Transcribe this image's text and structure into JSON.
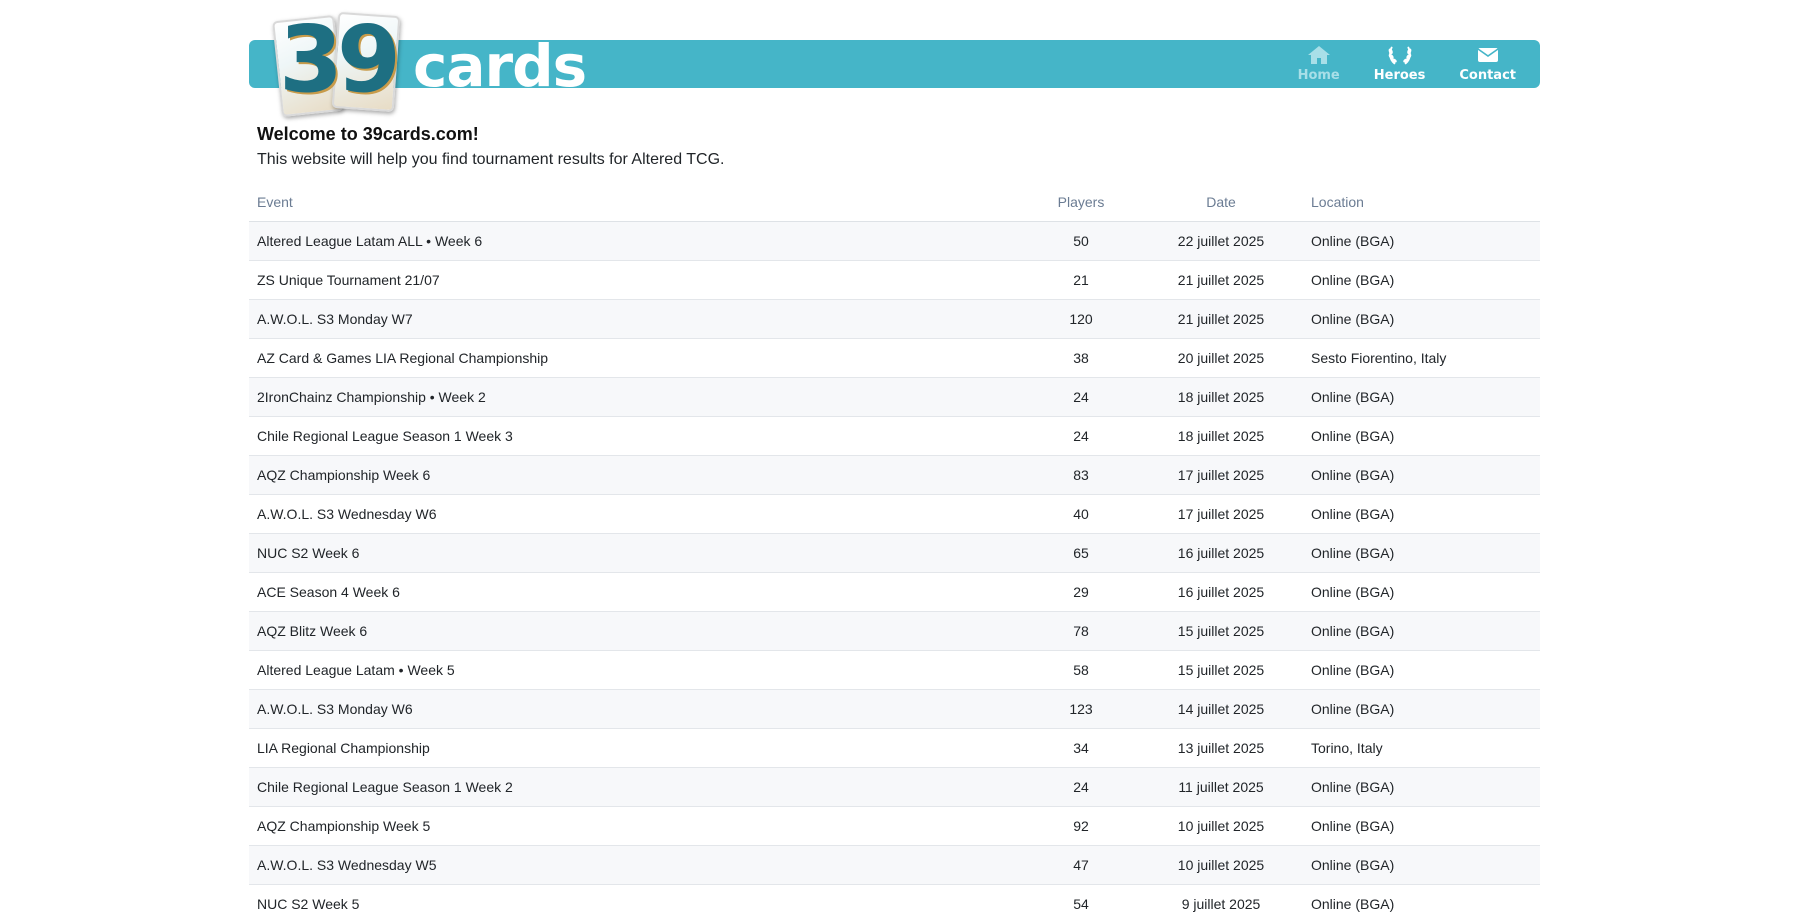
{
  "header": {
    "logo_digit_1": "3",
    "logo_digit_2": "9",
    "brand_text": "cards",
    "accent_color": "#45b5c8",
    "nav": [
      {
        "label": "Home",
        "icon": "home-icon"
      },
      {
        "label": "Heroes",
        "icon": "laurel-icon"
      },
      {
        "label": "Contact",
        "icon": "envelope-icon"
      }
    ]
  },
  "intro": {
    "welcome": "Welcome to 39cards.com!",
    "tagline": "This website will help you find tournament results for Altered TCG."
  },
  "table": {
    "columns": [
      "Event",
      "Players",
      "Date",
      "Location"
    ],
    "rows": [
      {
        "event": "Altered League Latam ALL • Week 6",
        "players": "50",
        "date": "22 juillet 2025",
        "location": "Online (BGA)"
      },
      {
        "event": "ZS Unique Tournament 21/07",
        "players": "21",
        "date": "21 juillet 2025",
        "location": "Online (BGA)"
      },
      {
        "event": "A.W.O.L. S3 Monday W7",
        "players": "120",
        "date": "21 juillet 2025",
        "location": "Online (BGA)"
      },
      {
        "event": "AZ Card & Games LIA Regional Championship",
        "players": "38",
        "date": "20 juillet 2025",
        "location": "Sesto Fiorentino, Italy"
      },
      {
        "event": "2IronChainz Championship • Week 2",
        "players": "24",
        "date": "18 juillet 2025",
        "location": "Online (BGA)"
      },
      {
        "event": "Chile Regional League Season 1 Week 3",
        "players": "24",
        "date": "18 juillet 2025",
        "location": "Online (BGA)"
      },
      {
        "event": "AQZ Championship Week 6",
        "players": "83",
        "date": "17 juillet 2025",
        "location": "Online (BGA)"
      },
      {
        "event": "A.W.O.L. S3 Wednesday W6",
        "players": "40",
        "date": "17 juillet 2025",
        "location": "Online (BGA)"
      },
      {
        "event": "NUC S2 Week 6",
        "players": "65",
        "date": "16 juillet 2025",
        "location": "Online (BGA)"
      },
      {
        "event": "ACE Season 4 Week 6",
        "players": "29",
        "date": "16 juillet 2025",
        "location": "Online (BGA)"
      },
      {
        "event": "AQZ Blitz Week 6",
        "players": "78",
        "date": "15 juillet 2025",
        "location": "Online (BGA)"
      },
      {
        "event": "Altered League Latam • Week 5",
        "players": "58",
        "date": "15 juillet 2025",
        "location": "Online (BGA)"
      },
      {
        "event": "A.W.O.L. S3 Monday W6",
        "players": "123",
        "date": "14 juillet 2025",
        "location": "Online (BGA)"
      },
      {
        "event": "LIA Regional Championship",
        "players": "34",
        "date": "13 juillet 2025",
        "location": "Torino, Italy"
      },
      {
        "event": "Chile Regional League Season 1 Week 2",
        "players": "24",
        "date": "11 juillet 2025",
        "location": "Online (BGA)"
      },
      {
        "event": "AQZ Championship Week 5",
        "players": "92",
        "date": "10 juillet 2025",
        "location": "Online (BGA)"
      },
      {
        "event": "A.W.O.L. S3 Wednesday W5",
        "players": "47",
        "date": "10 juillet 2025",
        "location": "Online (BGA)"
      },
      {
        "event": "NUC S2 Week 5",
        "players": "54",
        "date": "9 juillet 2025",
        "location": "Online (BGA)"
      }
    ]
  }
}
